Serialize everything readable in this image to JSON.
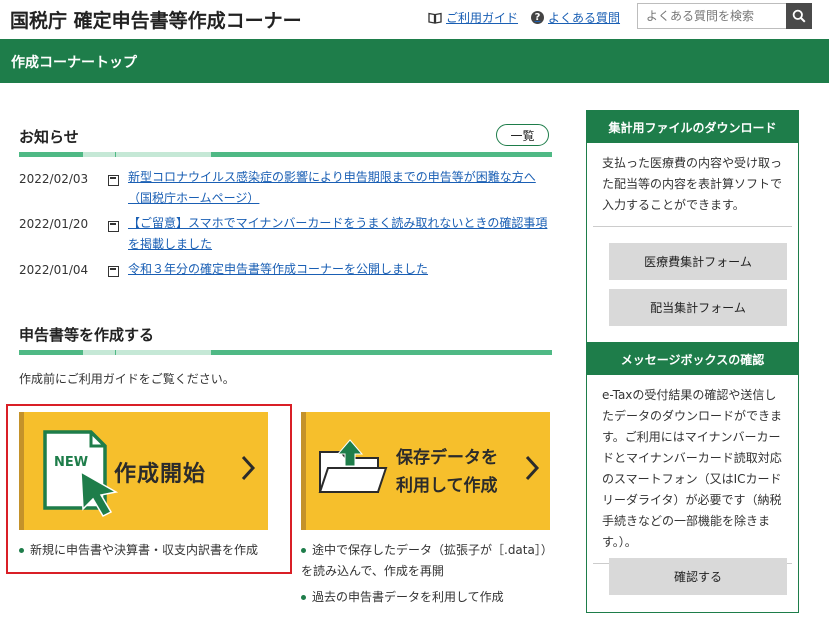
{
  "header": {
    "site_title": "国税庁 確定申告書等作成コーナー",
    "guide_link": "ご利用ガイド",
    "faq_link": "よくある質問",
    "faq_icon_glyph": "?",
    "search_placeholder": "よくある質問を検索"
  },
  "topbar": {
    "title": "作成コーナートップ"
  },
  "news": {
    "title": "お知らせ",
    "more_label": "一覧",
    "items": [
      {
        "date": "2022/02/03",
        "text": "新型コロナウイルス感染症の影響により申告期限までの申告等が困難な方へ（国税庁ホームページ）"
      },
      {
        "date": "2022/01/20",
        "text": "【ご留意】スマホでマイナンバーカードをうまく読み取れないときの確認事項を掲載しました"
      },
      {
        "date": "2022/01/04",
        "text": "令和３年分の確定申告書等作成コーナーを公開しました"
      }
    ]
  },
  "create": {
    "title": "申告書等を作成する",
    "intro": "作成前にご利用ガイドをご覧ください。",
    "new_card": {
      "label": "作成開始",
      "badge": "NEW"
    },
    "saved_card": {
      "line1": "保存データを",
      "line2": "利用して作成"
    },
    "new_bullets": [
      "新規に申告書や決算書・収支内訳書を作成"
    ],
    "saved_bullets": [
      "途中で保存したデータ（拡張子が［.data］）を読み込んで、作成を再開",
      "過去の申告書データを利用して作成"
    ]
  },
  "right_panel": {
    "download": {
      "title": "集計用ファイルのダウンロード",
      "text": "支払った医療費の内容や受け取った配当等の内容を表計算ソフトで入力することができます。",
      "btn_medical": "医療費集計フォーム",
      "btn_dividend": "配当集計フォーム"
    },
    "message": {
      "title": "メッセージボックスの確認",
      "text": "e-Taxの受付結果の確認や送信したデータのダウンロードができます。ご利用にはマイナンバーカードとマイナンバーカード読取対応のスマートフォン（又はICカードリーダライタ）が必要です（納税手続きなどの一部機能を除きます。）。",
      "btn_confirm": "確認する"
    }
  },
  "colors": {
    "brand_green": "#1e7d4a",
    "accent_green": "#4fb985",
    "card_yellow": "#f6bf2c",
    "link_blue": "#1a5fb4",
    "highlight_red": "#d91f26"
  },
  "icons": [
    "book-icon",
    "question-icon",
    "search-icon",
    "document-icon",
    "new-document-icon",
    "cursor-arrow-icon",
    "folder-upload-icon",
    "chevron-right-icon",
    "bullet-dot-icon"
  ]
}
